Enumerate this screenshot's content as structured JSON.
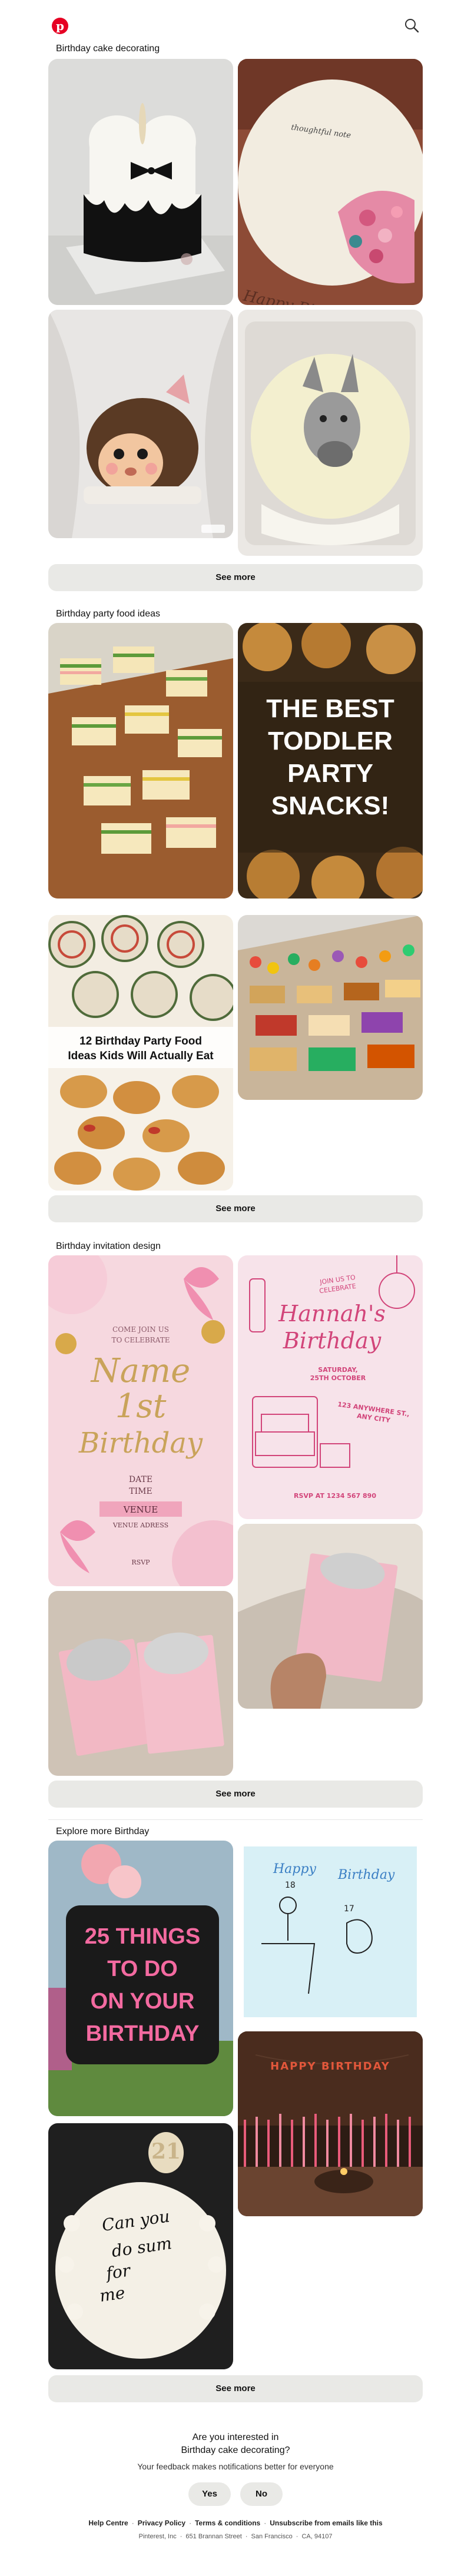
{
  "header": {
    "logo_letter": "p"
  },
  "sections": [
    {
      "title": "Birthday cake decorating",
      "see_more": "See more",
      "pins": [
        {
          "alt": "Heart-shaped white cake with black drip and bow",
          "text_lines": []
        },
        {
          "alt": "Round cream cake with pink flowers",
          "text_lines": [
            "Happy Birthday"
          ]
        },
        {
          "alt": "Hedgehog shaped chocolate cake",
          "text_lines": []
        },
        {
          "alt": "Cream cake with donkey drawing in box",
          "text_lines": []
        }
      ]
    },
    {
      "title": "Birthday party food ideas",
      "see_more": "See more",
      "pins": [
        {
          "alt": "Mini sandwiches on wooden board",
          "text_lines": []
        },
        {
          "alt": "Toddler party snacks graphic",
          "text_lines": [
            "THE BEST",
            "TODDLER",
            "PARTY",
            "SNACKS!"
          ]
        },
        {
          "alt": "Pinwheel wraps and croissant sandwiches",
          "text_lines": [
            "12 Birthday Party Food",
            "Ideas Kids Will Actually Eat"
          ]
        },
        {
          "alt": "Large grazing table with snacks",
          "text_lines": []
        }
      ]
    },
    {
      "title": "Birthday invitation design",
      "see_more": "See more",
      "pins": [
        {
          "alt": "Pink butterfly invitation",
          "text_lines": [
            "COME JOIN US",
            "TO CELEBRATE",
            "Name",
            "1st",
            "Birthday",
            "DATE",
            "TIME",
            "VENUE",
            "VENUE ADRESS",
            "RSVP"
          ]
        },
        {
          "alt": "Pink line-drawn invitation",
          "text_lines": [
            "JOIN US TO",
            "CELEBRATE",
            "Hannah's",
            "Birthday",
            "SATURDAY,",
            "25TH OCTOBER",
            "123 ANYWHERE ST.,",
            "ANY CITY",
            "RSVP AT 1234 567 890"
          ]
        },
        {
          "alt": "Disco ball invitation cards",
          "text_lines": []
        },
        {
          "alt": "Hand holding disco invitation card",
          "text_lines": []
        }
      ]
    },
    {
      "title": "Explore more Birthday",
      "see_more": "See more",
      "pins": [
        {
          "alt": "25 things to do on your birthday",
          "text_lines": [
            "25 THINGS",
            "TO DO",
            "ON YOUR",
            "BIRTHDAY"
          ]
        },
        {
          "alt": "Happy 18th birthday sketch",
          "text_lines": [
            "Happy",
            "18",
            "Birthday",
            "17"
          ]
        },
        {
          "alt": "Cake with candles",
          "text_lines": [
            "HAPPY BIRTHDAY"
          ]
        },
        {
          "alt": "Cake with piping writing",
          "text_lines": [
            "21",
            "Can you",
            "do sum",
            "for",
            "me"
          ]
        }
      ]
    }
  ],
  "survey": {
    "question_line1": "Are you interested in",
    "question_line2": "Birthday cake decorating?",
    "subtext": "Your feedback makes notifications better for everyone",
    "yes": "Yes",
    "no": "No"
  },
  "footer": {
    "links": [
      "Help Centre",
      "Privacy Policy",
      "Terms & conditions",
      "Unsubscribe from emails like this"
    ],
    "address": [
      "Pinterest, Inc",
      "651 Brannan Street",
      "San Francisco",
      "CA, 94107"
    ]
  },
  "colors": {
    "brand": "#e60023",
    "button_bg": "#e9e9e6",
    "footer_text": "#555555"
  }
}
